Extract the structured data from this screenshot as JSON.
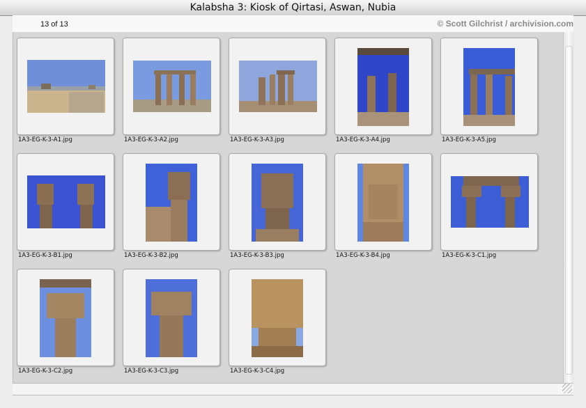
{
  "window": {
    "title": "Kalabsha 3: Kiosk of Qirtasi, Aswan, Nubia"
  },
  "toolbar": {
    "counter": "13 of 13",
    "copyright": "© Scott Gilchrist / archivision.com"
  },
  "thumbnails": [
    {
      "filename": "1A3-EG-K-3-A1.jpg",
      "subject": "distant-temple-landscape"
    },
    {
      "filename": "1A3-EG-K-3-A2.jpg",
      "subject": "kiosk-columns-front"
    },
    {
      "filename": "1A3-EG-K-3-A3.jpg",
      "subject": "kiosk-ruins-side"
    },
    {
      "filename": "1A3-EG-K-3-A4.jpg",
      "subject": "kiosk-interior-portrait"
    },
    {
      "filename": "1A3-EG-K-3-A5.jpg",
      "subject": "kiosk-columns-portrait"
    },
    {
      "filename": "1A3-EG-K-3-B1.jpg",
      "subject": "hathor-capitals-pair"
    },
    {
      "filename": "1A3-EG-K-3-B2.jpg",
      "subject": "hathor-column-portrait"
    },
    {
      "filename": "1A3-EG-K-3-B3.jpg",
      "subject": "hathor-capital-closeup"
    },
    {
      "filename": "1A3-EG-K-3-B4.jpg",
      "subject": "hathor-head-detail"
    },
    {
      "filename": "1A3-EG-K-3-C1.jpg",
      "subject": "columns-with-lintel"
    },
    {
      "filename": "1A3-EG-K-3-C2.jpg",
      "subject": "floral-capital"
    },
    {
      "filename": "1A3-EG-K-3-C3.jpg",
      "subject": "floral-capital-2"
    },
    {
      "filename": "1A3-EG-K-3-C4.jpg",
      "subject": "floral-capital-detail"
    }
  ]
}
